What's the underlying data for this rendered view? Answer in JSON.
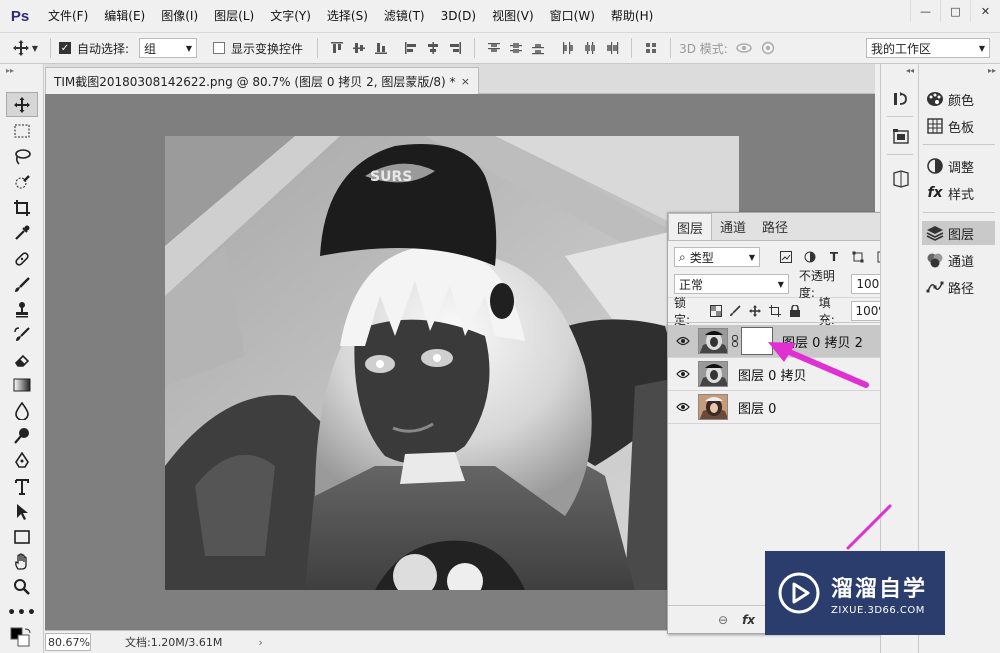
{
  "app": {
    "logo": "Ps"
  },
  "menu": [
    "文件(F)",
    "编辑(E)",
    "图像(I)",
    "图层(L)",
    "文字(Y)",
    "选择(S)",
    "滤镜(T)",
    "3D(D)",
    "视图(V)",
    "窗口(W)",
    "帮助(H)"
  ],
  "window_controls": {
    "minimize": "—",
    "maximize": "□",
    "close": "✕"
  },
  "options": {
    "auto_select_label": "自动选择:",
    "auto_select_checked": true,
    "auto_select_value": "组",
    "show_transform_label": "显示变换控件",
    "show_transform_checked": false,
    "mode3d_label": "3D 模式:",
    "workspace": "我的工作区"
  },
  "document": {
    "tab_title": "TIM截图20180308142622.png @ 80.7% (图层 0 拷贝 2, 图层蒙版/8) *",
    "close": "×"
  },
  "status": {
    "zoom": "80.67%",
    "doc_info": "文档:1.20M/3.61M"
  },
  "layers_panel": {
    "tabs": [
      "图层",
      "通道",
      "路径"
    ],
    "filter_kind": "类型",
    "blend_mode": "正常",
    "opacity_label": "不透明度:",
    "opacity": "100%",
    "lock_label": "锁定:",
    "fill_label": "填充:",
    "fill": "100%",
    "layers": [
      {
        "name": "图层 0 拷贝 2",
        "selected": true,
        "has_mask": true
      },
      {
        "name": "图层 0 拷贝",
        "selected": false,
        "has_mask": false
      },
      {
        "name": "图层 0",
        "selected": false,
        "has_mask": false
      }
    ]
  },
  "dock": {
    "items": [
      "颜色",
      "色板",
      "调整",
      "样式",
      "图层",
      "通道",
      "路径"
    ],
    "active": "图层"
  },
  "watermark": {
    "title": "溜溜自学",
    "url": "ZIXUE.3D66.COM"
  },
  "colors": {
    "accent_arrow": "#e02fd2",
    "watermark_bg": "#2b3d6d",
    "canvas_bg": "#7f7f7f"
  }
}
